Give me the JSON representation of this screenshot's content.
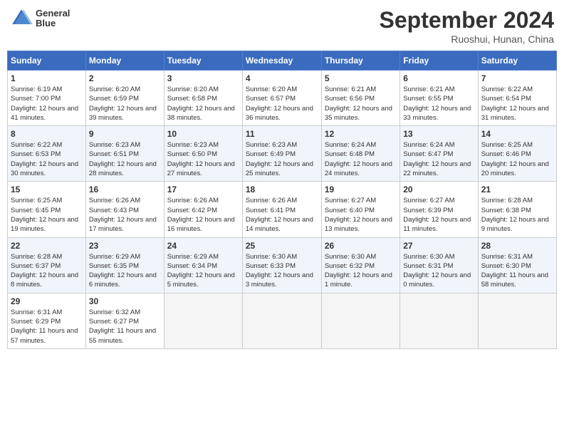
{
  "header": {
    "logo_line1": "General",
    "logo_line2": "Blue",
    "month": "September 2024",
    "location": "Ruoshui, Hunan, China"
  },
  "days_of_week": [
    "Sunday",
    "Monday",
    "Tuesday",
    "Wednesday",
    "Thursday",
    "Friday",
    "Saturday"
  ],
  "weeks": [
    [
      {
        "day": "1",
        "sunrise": "6:19 AM",
        "sunset": "7:00 PM",
        "daylight": "12 hours and 41 minutes."
      },
      {
        "day": "2",
        "sunrise": "6:20 AM",
        "sunset": "6:59 PM",
        "daylight": "12 hours and 39 minutes."
      },
      {
        "day": "3",
        "sunrise": "6:20 AM",
        "sunset": "6:58 PM",
        "daylight": "12 hours and 38 minutes."
      },
      {
        "day": "4",
        "sunrise": "6:20 AM",
        "sunset": "6:57 PM",
        "daylight": "12 hours and 36 minutes."
      },
      {
        "day": "5",
        "sunrise": "6:21 AM",
        "sunset": "6:56 PM",
        "daylight": "12 hours and 35 minutes."
      },
      {
        "day": "6",
        "sunrise": "6:21 AM",
        "sunset": "6:55 PM",
        "daylight": "12 hours and 33 minutes."
      },
      {
        "day": "7",
        "sunrise": "6:22 AM",
        "sunset": "6:54 PM",
        "daylight": "12 hours and 31 minutes."
      }
    ],
    [
      {
        "day": "8",
        "sunrise": "6:22 AM",
        "sunset": "6:53 PM",
        "daylight": "12 hours and 30 minutes."
      },
      {
        "day": "9",
        "sunrise": "6:23 AM",
        "sunset": "6:51 PM",
        "daylight": "12 hours and 28 minutes."
      },
      {
        "day": "10",
        "sunrise": "6:23 AM",
        "sunset": "6:50 PM",
        "daylight": "12 hours and 27 minutes."
      },
      {
        "day": "11",
        "sunrise": "6:23 AM",
        "sunset": "6:49 PM",
        "daylight": "12 hours and 25 minutes."
      },
      {
        "day": "12",
        "sunrise": "6:24 AM",
        "sunset": "6:48 PM",
        "daylight": "12 hours and 24 minutes."
      },
      {
        "day": "13",
        "sunrise": "6:24 AM",
        "sunset": "6:47 PM",
        "daylight": "12 hours and 22 minutes."
      },
      {
        "day": "14",
        "sunrise": "6:25 AM",
        "sunset": "6:46 PM",
        "daylight": "12 hours and 20 minutes."
      }
    ],
    [
      {
        "day": "15",
        "sunrise": "6:25 AM",
        "sunset": "6:45 PM",
        "daylight": "12 hours and 19 minutes."
      },
      {
        "day": "16",
        "sunrise": "6:26 AM",
        "sunset": "6:43 PM",
        "daylight": "12 hours and 17 minutes."
      },
      {
        "day": "17",
        "sunrise": "6:26 AM",
        "sunset": "6:42 PM",
        "daylight": "12 hours and 16 minutes."
      },
      {
        "day": "18",
        "sunrise": "6:26 AM",
        "sunset": "6:41 PM",
        "daylight": "12 hours and 14 minutes."
      },
      {
        "day": "19",
        "sunrise": "6:27 AM",
        "sunset": "6:40 PM",
        "daylight": "12 hours and 13 minutes."
      },
      {
        "day": "20",
        "sunrise": "6:27 AM",
        "sunset": "6:39 PM",
        "daylight": "12 hours and 11 minutes."
      },
      {
        "day": "21",
        "sunrise": "6:28 AM",
        "sunset": "6:38 PM",
        "daylight": "12 hours and 9 minutes."
      }
    ],
    [
      {
        "day": "22",
        "sunrise": "6:28 AM",
        "sunset": "6:37 PM",
        "daylight": "12 hours and 8 minutes."
      },
      {
        "day": "23",
        "sunrise": "6:29 AM",
        "sunset": "6:35 PM",
        "daylight": "12 hours and 6 minutes."
      },
      {
        "day": "24",
        "sunrise": "6:29 AM",
        "sunset": "6:34 PM",
        "daylight": "12 hours and 5 minutes."
      },
      {
        "day": "25",
        "sunrise": "6:30 AM",
        "sunset": "6:33 PM",
        "daylight": "12 hours and 3 minutes."
      },
      {
        "day": "26",
        "sunrise": "6:30 AM",
        "sunset": "6:32 PM",
        "daylight": "12 hours and 1 minute."
      },
      {
        "day": "27",
        "sunrise": "6:30 AM",
        "sunset": "6:31 PM",
        "daylight": "12 hours and 0 minutes."
      },
      {
        "day": "28",
        "sunrise": "6:31 AM",
        "sunset": "6:30 PM",
        "daylight": "11 hours and 58 minutes."
      }
    ],
    [
      {
        "day": "29",
        "sunrise": "6:31 AM",
        "sunset": "6:29 PM",
        "daylight": "11 hours and 57 minutes."
      },
      {
        "day": "30",
        "sunrise": "6:32 AM",
        "sunset": "6:27 PM",
        "daylight": "11 hours and 55 minutes."
      },
      null,
      null,
      null,
      null,
      null
    ]
  ]
}
